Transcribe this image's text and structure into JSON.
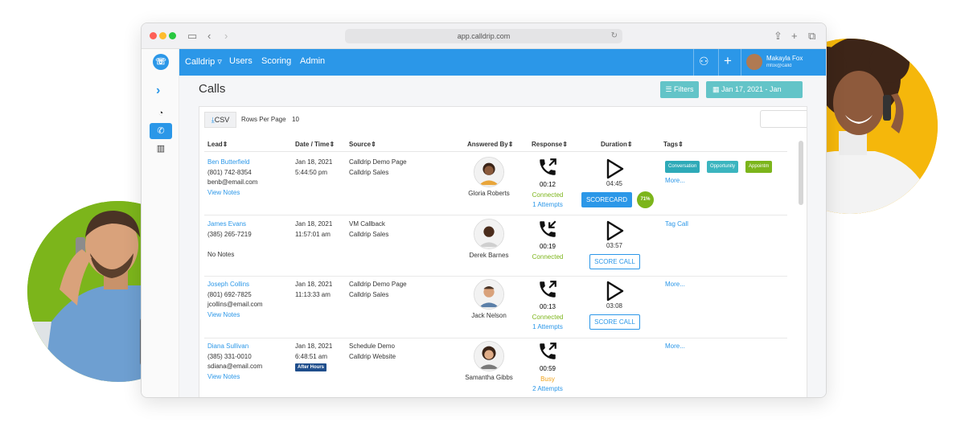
{
  "browser": {
    "url": "app.calldrip.com"
  },
  "nav": {
    "brand": "Calldrip",
    "items": [
      "Users",
      "Scoring",
      "Admin"
    ],
    "user_name": "Makayla Fox",
    "user_email": "mfox@calld"
  },
  "page": {
    "title": "Calls",
    "filters_label": "Filters",
    "date_label": "Jan 17, 2021 - Jan"
  },
  "table_controls": {
    "csv_label": "CSV",
    "rows_per_page_label": "Rows Per Page",
    "rows_per_page_value": "10"
  },
  "columns": [
    "Lead",
    "Date / Time",
    "Source",
    "Answered By",
    "Response",
    "Duration",
    "Tags"
  ],
  "rows": [
    {
      "lead_name": "Ben Butterfield",
      "phone": "(801) 742-8354",
      "email": "benb@email.com",
      "notes": "View Notes",
      "date": "Jan 18, 2021",
      "time": "5:44:50 pm",
      "source1": "Calldrip Demo Page",
      "source2": "Calldrip Sales",
      "agent": "Gloria Roberts",
      "response_time": "00:12",
      "status": "Connected",
      "attempts": "1 Attempts",
      "duration": "04:45",
      "score_label": "SCORECARD",
      "score_pct": "71%",
      "tags": [
        "Conversation",
        "Opportunity",
        "Appointm"
      ],
      "more": "More..."
    },
    {
      "lead_name": "James Evans",
      "phone": "(385) 265-7219",
      "email": "",
      "notes": "No Notes",
      "date": "Jan 18, 2021",
      "time": "11:57:01 am",
      "source1": "VM Callback",
      "source2": "Calldrip Sales",
      "agent": "Derek Barnes",
      "response_time": "00:19",
      "status": "Connected",
      "attempts": "",
      "duration": "03:57",
      "score_label": "SCORE CALL",
      "tag_link": "Tag Call"
    },
    {
      "lead_name": "Joseph Collins",
      "phone": "(801) 692-7825",
      "email": "jcollins@email.com",
      "notes": "View Notes",
      "date": "Jan 18, 2021",
      "time": "11:13:33 am",
      "source1": "Calldrip Demo Page",
      "source2": "Calldrip Sales",
      "agent": "Jack Nelson",
      "response_time": "00:13",
      "status": "Connected",
      "attempts": "1 Attempts",
      "duration": "03:08",
      "score_label": "SCORE CALL",
      "more": "More..."
    },
    {
      "lead_name": "Diana Sullivan",
      "phone": "(385) 331-0010",
      "email": "sdiana@email.com",
      "notes": "View Notes",
      "date": "Jan 18, 2021",
      "time": "6:48:51 am",
      "badge": "After Hours",
      "source1": "Schedule Demo",
      "source2": "Calldrip Website",
      "agent": "Samantha Gibbs",
      "response_time": "00:59",
      "status": "Busy",
      "attempts": "2 Attempts",
      "more": "More..."
    }
  ],
  "colors": {
    "primary": "#2b97e8",
    "teal": "#63c4c8",
    "green": "#7cb51b",
    "busy": "#f0a21a",
    "tag_conversation": "#2eaab8",
    "tag_opportunity": "#3bb5bf",
    "tag_appointment": "#7cb51b",
    "left_circle": "#7cb51b",
    "right_circle": "#f5b70b"
  },
  "icons": [
    "sidebar-toggle-icon",
    "back-icon",
    "forward-icon",
    "share-icon",
    "new-tab-icon",
    "tabs-icon",
    "calldrip-logo-icon",
    "expand-icon",
    "dashboard-icon",
    "calls-icon",
    "reports-icon",
    "org-chart-icon",
    "plus-icon",
    "download-icon",
    "phone-outgoing-icon",
    "phone-incoming-icon",
    "play-icon"
  ]
}
